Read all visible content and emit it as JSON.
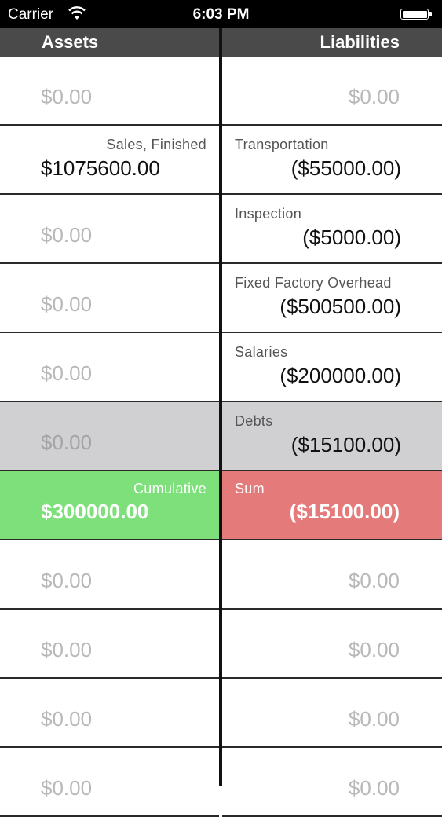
{
  "status_bar": {
    "carrier": "Carrier",
    "time": "6:03 PM",
    "icons": [
      "wifi-icon",
      "battery-icon"
    ]
  },
  "header": {
    "assets_title": "Assets",
    "liabilities_title": "Liabilities"
  },
  "colors": {
    "header_bg": "#4a4a4a",
    "placeholder_text": "#b8b8b8",
    "highlight_gray": "#d0d0d2",
    "cumulative_green": "#7de07a",
    "sum_red": "#e57a7a"
  },
  "rows": [
    {
      "asset_label": "",
      "asset_value": "$0.00",
      "liability_label": "",
      "liability_value": "$0.00"
    },
    {
      "asset_label": "Sales, Finished",
      "asset_value": "$1075600.00",
      "liability_label": "Transportation",
      "liability_value": "($55000.00)"
    },
    {
      "asset_label": "",
      "asset_value": "$0.00",
      "liability_label": "Inspection",
      "liability_value": "($5000.00)"
    },
    {
      "asset_label": "",
      "asset_value": "$0.00",
      "liability_label": "Fixed Factory Overhead",
      "liability_value": "($500500.00)"
    },
    {
      "asset_label": "",
      "asset_value": "$0.00",
      "liability_label": "Salaries",
      "liability_value": "($200000.00)"
    },
    {
      "asset_label": "",
      "asset_value": "$0.00",
      "liability_label": "Debts",
      "liability_value": "($15100.00)"
    },
    {
      "asset_label": "Cumulative",
      "asset_value": "$300000.00",
      "liability_label": "Sum",
      "liability_value": "($15100.00)"
    },
    {
      "asset_label": "",
      "asset_value": "$0.00",
      "liability_label": "",
      "liability_value": "$0.00"
    },
    {
      "asset_label": "",
      "asset_value": "$0.00",
      "liability_label": "",
      "liability_value": "$0.00"
    },
    {
      "asset_label": "",
      "asset_value": "$0.00",
      "liability_label": "",
      "liability_value": "$0.00"
    },
    {
      "asset_label": "",
      "asset_value": "$0.00",
      "liability_label": "",
      "liability_value": "$0.00"
    }
  ]
}
